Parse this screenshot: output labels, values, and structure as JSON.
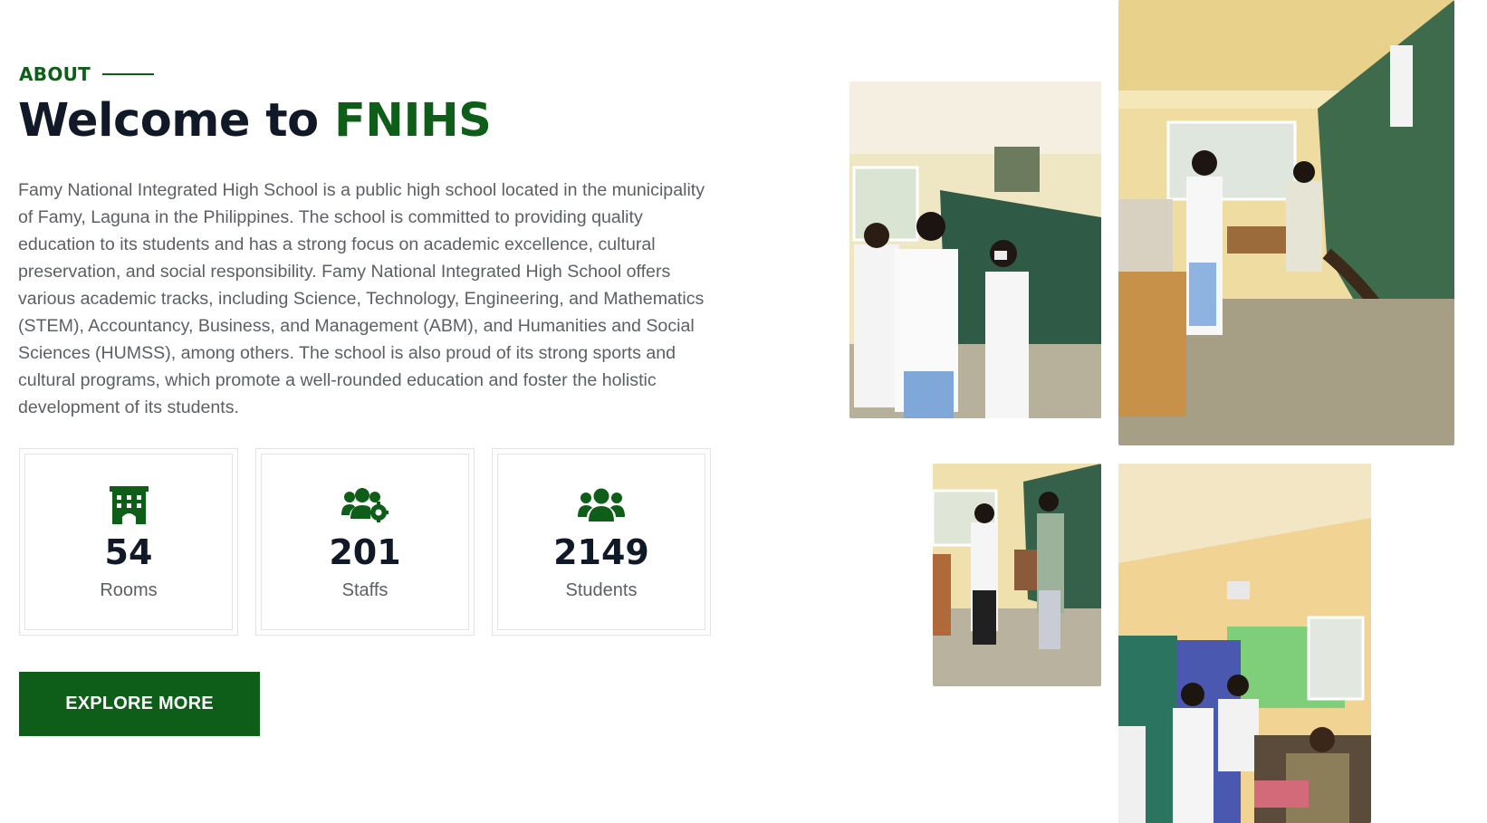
{
  "about": {
    "label": "ABOUT"
  },
  "heading": {
    "prefix": "Welcome to",
    "highlight": "FNIHS"
  },
  "description": "Famy National Integrated High School is a public high school located in the municipality of Famy, Laguna in the Philippines. The school is committed to providing quality education to its students and has a strong focus on academic excellence, cultural preservation, and social responsibility. Famy National Integrated High School offers various academic tracks, including Science, Technology, Engineering, and Mathematics (STEM), Accountancy, Business, and Management (ABM), and Humanities and Social Sciences (HUMSS), among others. The school is also proud of its strong sports and cultural programs, which promote a well-rounded education and foster the holistic development of its students.",
  "stats": [
    {
      "icon": "building-icon",
      "value": "54",
      "label": "Rooms"
    },
    {
      "icon": "users-cog-icon",
      "value": "201",
      "label": "Staffs"
    },
    {
      "icon": "users-icon",
      "value": "2149",
      "label": "Students"
    }
  ],
  "cta": {
    "label": "EXPLORE MORE"
  },
  "colors": {
    "accent": "#0e5e1a",
    "heading": "#111827",
    "body_text": "#5b5f66",
    "border": "#e3e3e3"
  },
  "gallery": [
    {
      "name": "classroom-photo-blackboard"
    },
    {
      "name": "classroom-photo-teacher-desk"
    },
    {
      "name": "classroom-photo-students-standing"
    },
    {
      "name": "classroom-photo-lockers"
    }
  ]
}
